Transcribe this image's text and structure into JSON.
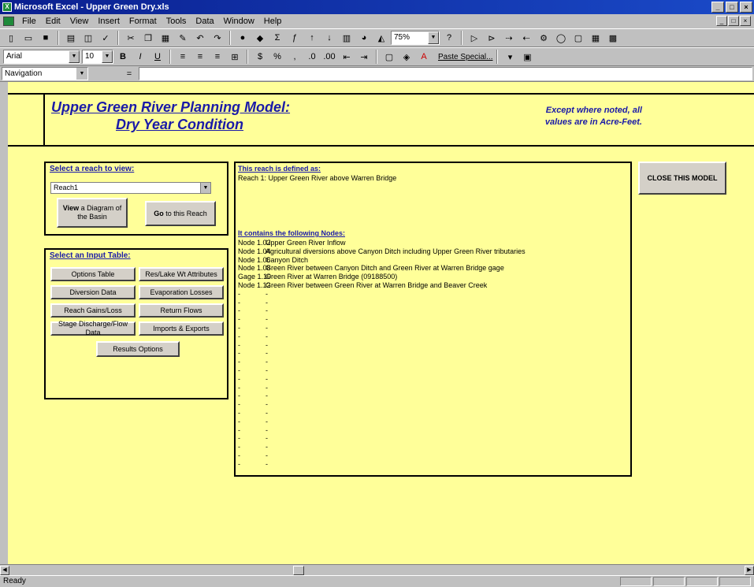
{
  "window": {
    "title": "Microsoft Excel - Upper Green Dry.xls"
  },
  "menu": [
    "File",
    "Edit",
    "View",
    "Insert",
    "Format",
    "Tools",
    "Data",
    "Window",
    "Help"
  ],
  "toolbar": {
    "zoom": "75%",
    "font": "Arial",
    "font_size": "10",
    "paste_special": "Paste Special..."
  },
  "name_box": "Navigation",
  "sheet": {
    "title": "Upper Green River Planning Model:",
    "subtitle": "Dry Year Condition",
    "units_note_1": "Except where noted, all",
    "units_note_2": "values are in Acre-Feet."
  },
  "reach_panel": {
    "title": "Select a reach to view:",
    "selected": "Reach1",
    "view_button_bold": "View",
    "view_button_rest": "a Diagram of the Basin",
    "go_button_bold": "Go",
    "go_button_rest": "to this Reach"
  },
  "input_panel": {
    "title": "Select an Input Table:",
    "buttons": [
      "Options Table",
      "Res/Lake Wt Attributes",
      "Diversion Data",
      "Evaporation Losses",
      "Reach Gains/Loss",
      "Return Flows",
      "Stage Discharge/Flow Data",
      "Imports & Exports",
      "Results Options"
    ]
  },
  "info_panel": {
    "defined_label": "This reach is defined as:",
    "reach_definition": "Reach 1: Upper Green River above Warren Bridge",
    "nodes_label": "It contains the following Nodes:",
    "nodes": [
      {
        "id": "Node 1.02",
        "desc": "Upper Green River Inflow"
      },
      {
        "id": "Node 1.04",
        "desc": "Agricultural diversions above Canyon Ditch including Upper Green River tributaries"
      },
      {
        "id": "Node 1.06",
        "desc": "Canyon Ditch"
      },
      {
        "id": "Node 1.08",
        "desc": "Green River between Canyon Ditch and Green River at Warren Bridge gage"
      },
      {
        "id": "Gage 1.10",
        "desc": "Green River at Warren Bridge (09188500)"
      },
      {
        "id": "Node 1.12",
        "desc": "Green River between Green River at Warren Bridge and Beaver Creek"
      }
    ],
    "empty_rows": 21,
    "empty_marker": "-"
  },
  "close_button": "CLOSE THIS MODEL",
  "status": "Ready"
}
